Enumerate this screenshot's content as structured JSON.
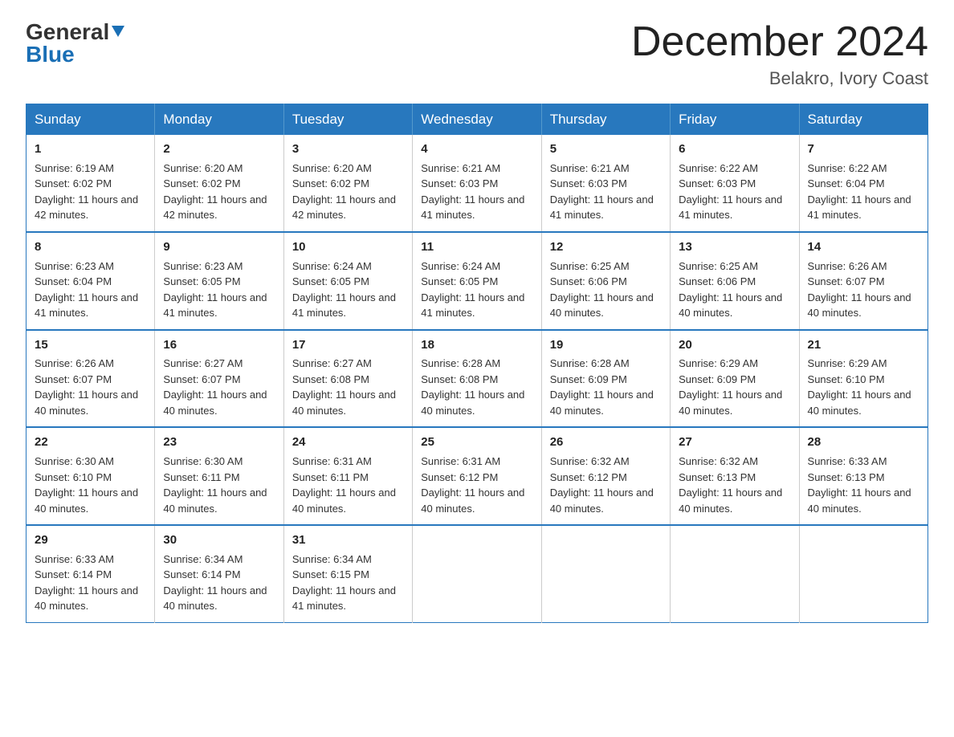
{
  "header": {
    "logo_general": "General",
    "logo_blue": "Blue",
    "month_title": "December 2024",
    "location": "Belakro, Ivory Coast"
  },
  "days_of_week": [
    "Sunday",
    "Monday",
    "Tuesday",
    "Wednesday",
    "Thursday",
    "Friday",
    "Saturday"
  ],
  "weeks": [
    [
      {
        "day": "1",
        "sunrise": "6:19 AM",
        "sunset": "6:02 PM",
        "daylight": "11 hours and 42 minutes."
      },
      {
        "day": "2",
        "sunrise": "6:20 AM",
        "sunset": "6:02 PM",
        "daylight": "11 hours and 42 minutes."
      },
      {
        "day": "3",
        "sunrise": "6:20 AM",
        "sunset": "6:02 PM",
        "daylight": "11 hours and 42 minutes."
      },
      {
        "day": "4",
        "sunrise": "6:21 AM",
        "sunset": "6:03 PM",
        "daylight": "11 hours and 41 minutes."
      },
      {
        "day": "5",
        "sunrise": "6:21 AM",
        "sunset": "6:03 PM",
        "daylight": "11 hours and 41 minutes."
      },
      {
        "day": "6",
        "sunrise": "6:22 AM",
        "sunset": "6:03 PM",
        "daylight": "11 hours and 41 minutes."
      },
      {
        "day": "7",
        "sunrise": "6:22 AM",
        "sunset": "6:04 PM",
        "daylight": "11 hours and 41 minutes."
      }
    ],
    [
      {
        "day": "8",
        "sunrise": "6:23 AM",
        "sunset": "6:04 PM",
        "daylight": "11 hours and 41 minutes."
      },
      {
        "day": "9",
        "sunrise": "6:23 AM",
        "sunset": "6:05 PM",
        "daylight": "11 hours and 41 minutes."
      },
      {
        "day": "10",
        "sunrise": "6:24 AM",
        "sunset": "6:05 PM",
        "daylight": "11 hours and 41 minutes."
      },
      {
        "day": "11",
        "sunrise": "6:24 AM",
        "sunset": "6:05 PM",
        "daylight": "11 hours and 41 minutes."
      },
      {
        "day": "12",
        "sunrise": "6:25 AM",
        "sunset": "6:06 PM",
        "daylight": "11 hours and 40 minutes."
      },
      {
        "day": "13",
        "sunrise": "6:25 AM",
        "sunset": "6:06 PM",
        "daylight": "11 hours and 40 minutes."
      },
      {
        "day": "14",
        "sunrise": "6:26 AM",
        "sunset": "6:07 PM",
        "daylight": "11 hours and 40 minutes."
      }
    ],
    [
      {
        "day": "15",
        "sunrise": "6:26 AM",
        "sunset": "6:07 PM",
        "daylight": "11 hours and 40 minutes."
      },
      {
        "day": "16",
        "sunrise": "6:27 AM",
        "sunset": "6:07 PM",
        "daylight": "11 hours and 40 minutes."
      },
      {
        "day": "17",
        "sunrise": "6:27 AM",
        "sunset": "6:08 PM",
        "daylight": "11 hours and 40 minutes."
      },
      {
        "day": "18",
        "sunrise": "6:28 AM",
        "sunset": "6:08 PM",
        "daylight": "11 hours and 40 minutes."
      },
      {
        "day": "19",
        "sunrise": "6:28 AM",
        "sunset": "6:09 PM",
        "daylight": "11 hours and 40 minutes."
      },
      {
        "day": "20",
        "sunrise": "6:29 AM",
        "sunset": "6:09 PM",
        "daylight": "11 hours and 40 minutes."
      },
      {
        "day": "21",
        "sunrise": "6:29 AM",
        "sunset": "6:10 PM",
        "daylight": "11 hours and 40 minutes."
      }
    ],
    [
      {
        "day": "22",
        "sunrise": "6:30 AM",
        "sunset": "6:10 PM",
        "daylight": "11 hours and 40 minutes."
      },
      {
        "day": "23",
        "sunrise": "6:30 AM",
        "sunset": "6:11 PM",
        "daylight": "11 hours and 40 minutes."
      },
      {
        "day": "24",
        "sunrise": "6:31 AM",
        "sunset": "6:11 PM",
        "daylight": "11 hours and 40 minutes."
      },
      {
        "day": "25",
        "sunrise": "6:31 AM",
        "sunset": "6:12 PM",
        "daylight": "11 hours and 40 minutes."
      },
      {
        "day": "26",
        "sunrise": "6:32 AM",
        "sunset": "6:12 PM",
        "daylight": "11 hours and 40 minutes."
      },
      {
        "day": "27",
        "sunrise": "6:32 AM",
        "sunset": "6:13 PM",
        "daylight": "11 hours and 40 minutes."
      },
      {
        "day": "28",
        "sunrise": "6:33 AM",
        "sunset": "6:13 PM",
        "daylight": "11 hours and 40 minutes."
      }
    ],
    [
      {
        "day": "29",
        "sunrise": "6:33 AM",
        "sunset": "6:14 PM",
        "daylight": "11 hours and 40 minutes."
      },
      {
        "day": "30",
        "sunrise": "6:34 AM",
        "sunset": "6:14 PM",
        "daylight": "11 hours and 40 minutes."
      },
      {
        "day": "31",
        "sunrise": "6:34 AM",
        "sunset": "6:15 PM",
        "daylight": "11 hours and 41 minutes."
      },
      null,
      null,
      null,
      null
    ]
  ],
  "labels": {
    "sunrise": "Sunrise:",
    "sunset": "Sunset:",
    "daylight": "Daylight:"
  }
}
